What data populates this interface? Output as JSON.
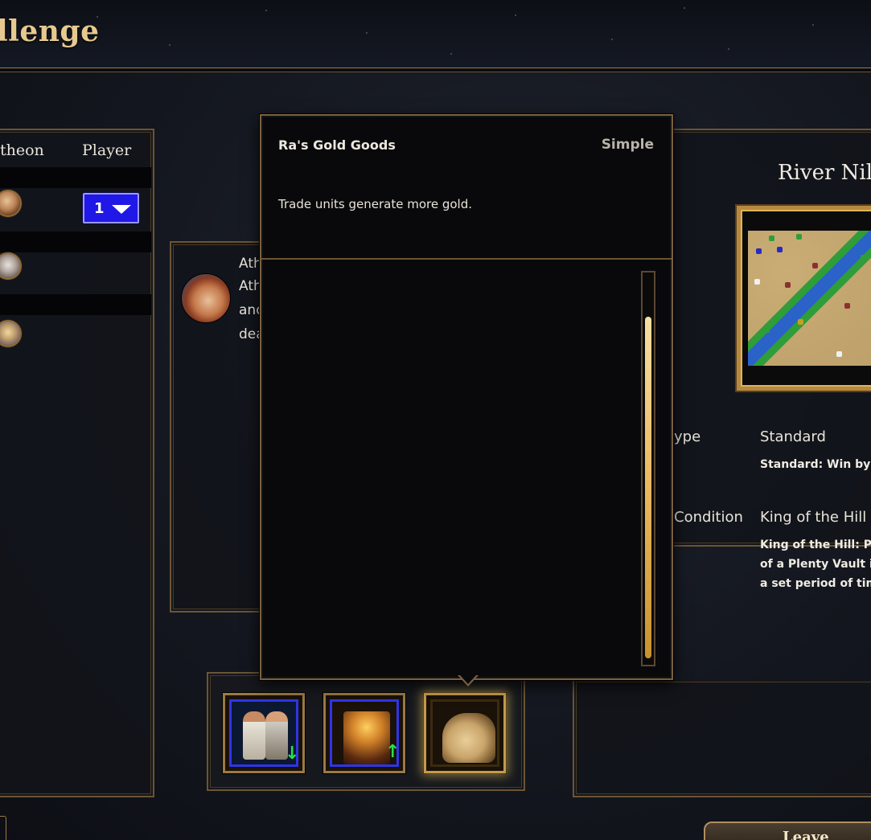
{
  "header": {
    "title": "llenge"
  },
  "players": {
    "col_pantheon": "theon",
    "col_player": "Player",
    "selected_player": "1"
  },
  "civ": {
    "lines": [
      "Ath",
      "Ath",
      "and",
      "dea"
    ]
  },
  "tooltip": {
    "name": "Ra's Gold Goods",
    "type": "Simple",
    "description": "Trade units generate more gold."
  },
  "blessings": [
    {
      "icon": "villagers-down-icon",
      "selected": false
    },
    {
      "icon": "tools-up-icon",
      "selected": false
    },
    {
      "icon": "camel-icon",
      "selected": true
    }
  ],
  "map": {
    "name": "River Nil",
    "type_label": "ype",
    "type_value": "Standard",
    "type_desc": "Standard: Win by",
    "condition_label": "Condition",
    "condition_value": "King of the Hill",
    "condition_desc": [
      "King of the Hill: Pl",
      "of a Plenty Vault i",
      "a set period of tim"
    ]
  },
  "footer": {
    "leave_label": "Leave"
  },
  "colors": {
    "accent_gold": "#e6c98f",
    "player_blue": "#2018e6",
    "frame": "#6b5535"
  }
}
